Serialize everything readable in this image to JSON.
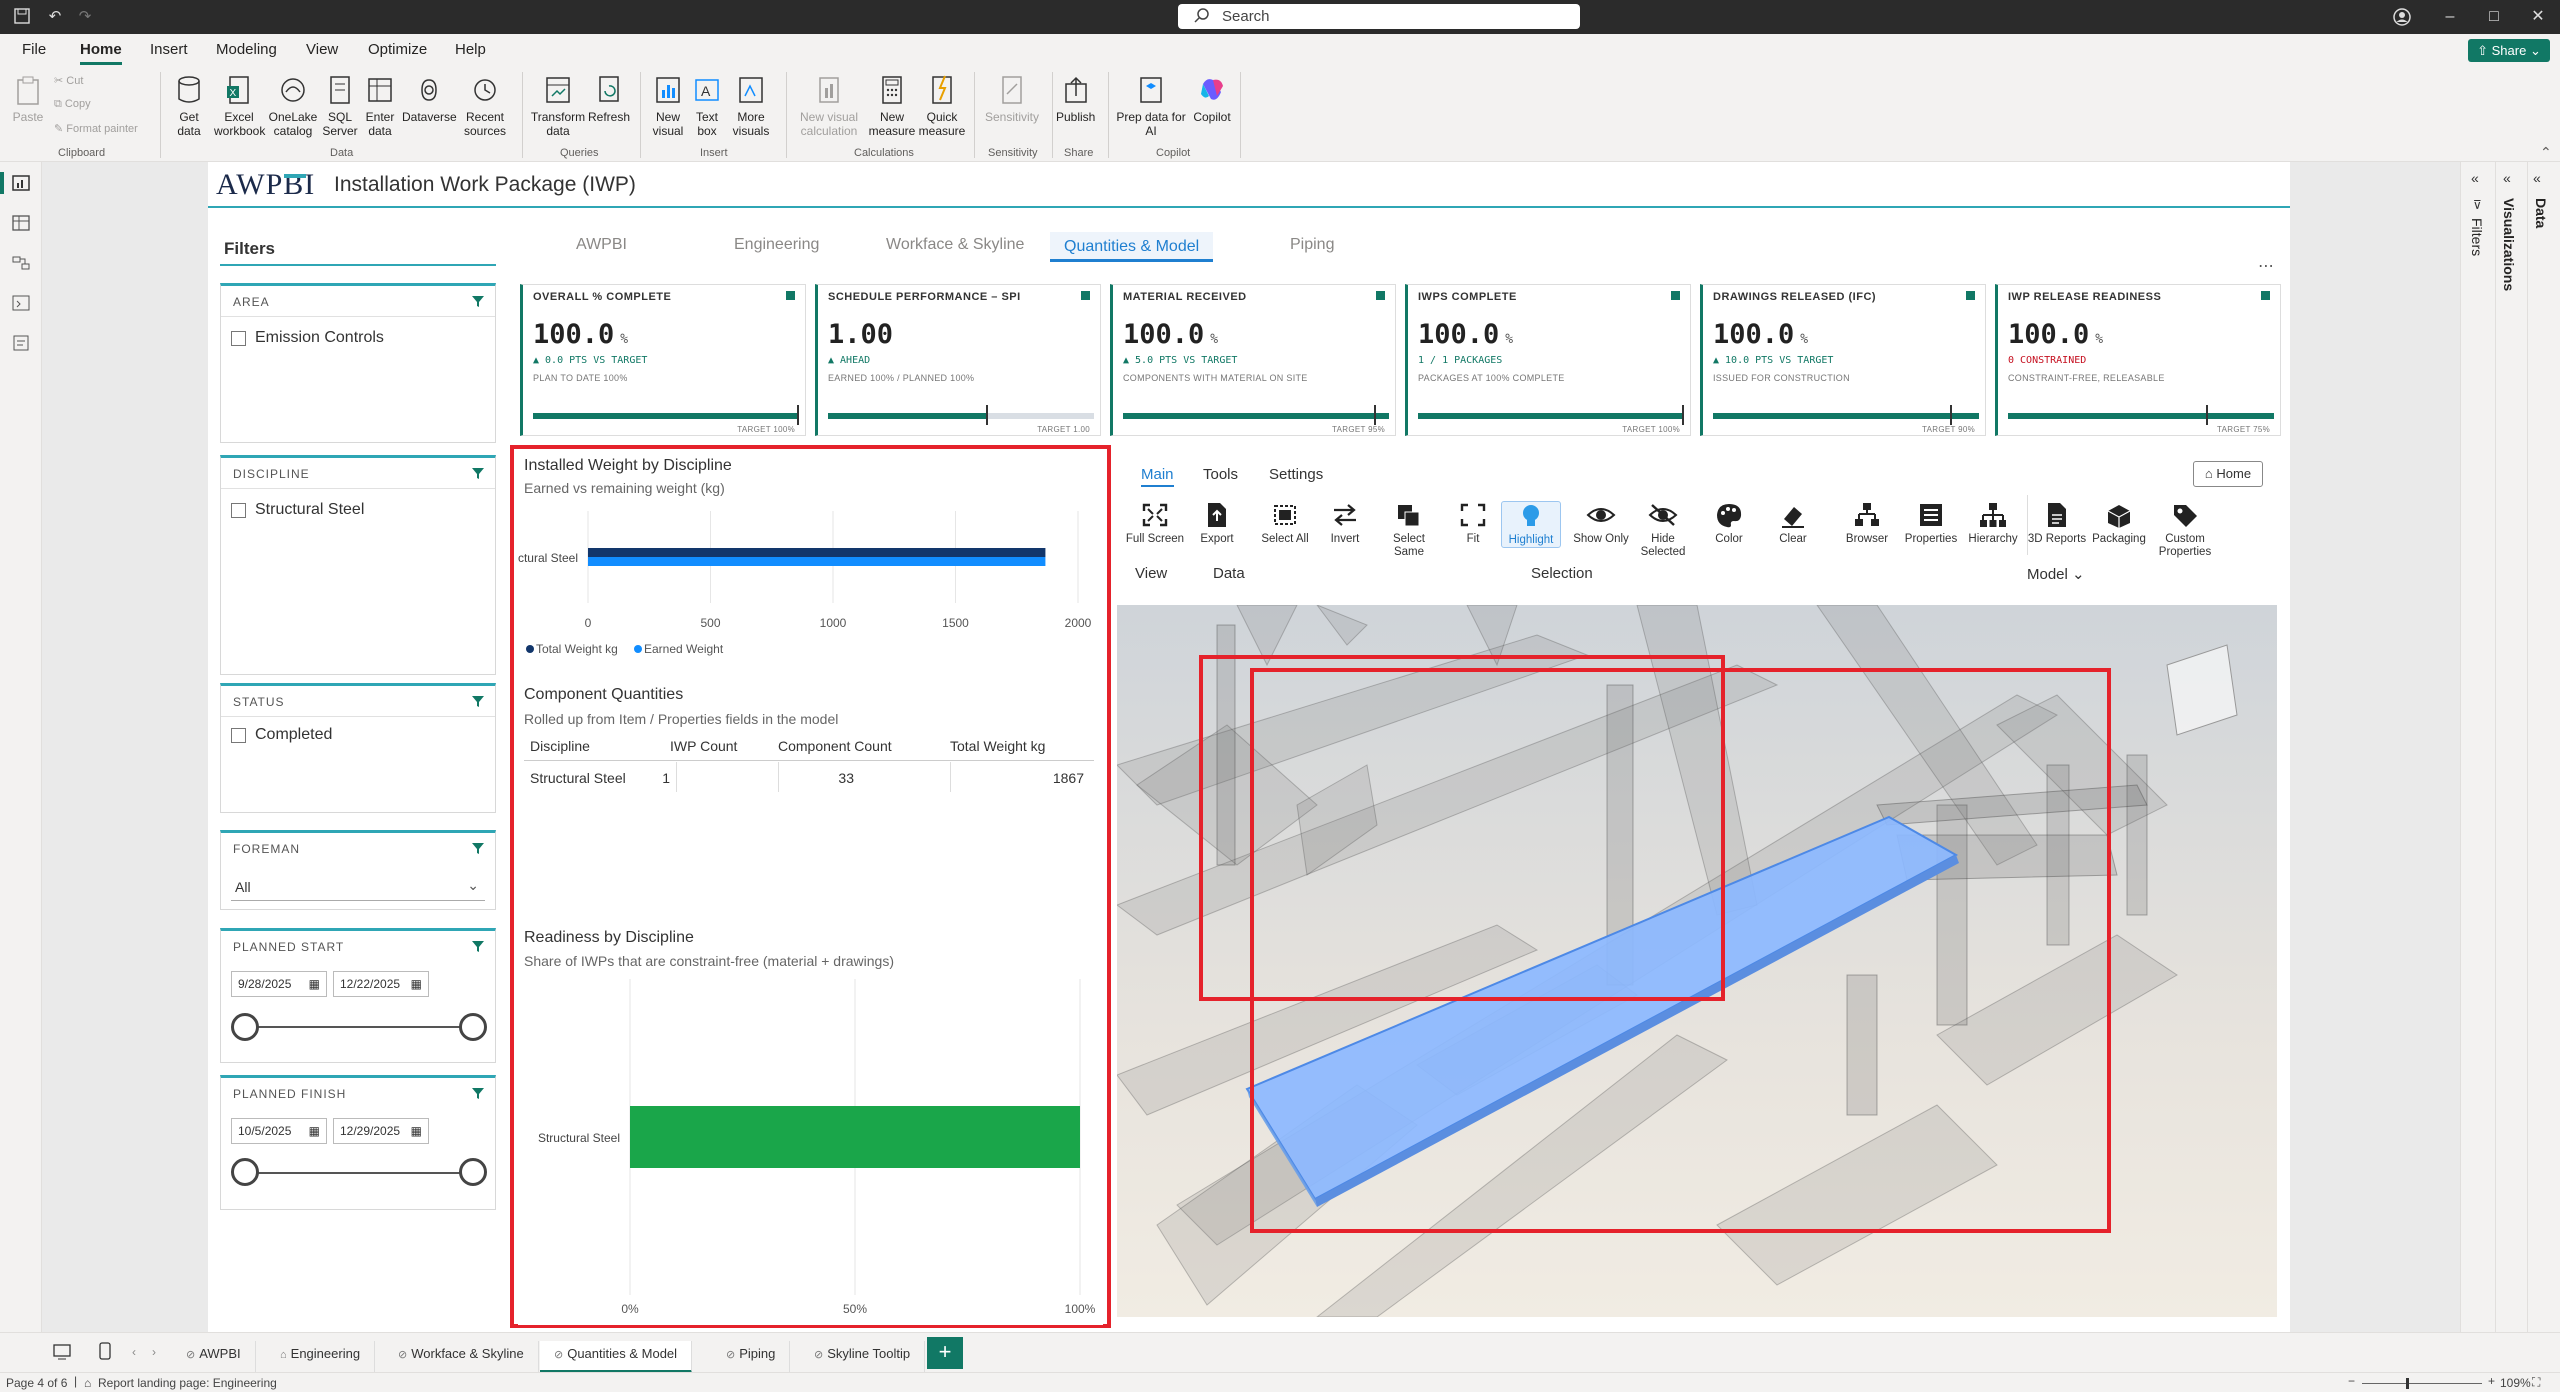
{
  "app": {
    "search_placeholder": "Search",
    "share_label": "Share"
  },
  "menu": [
    "File",
    "Home",
    "Insert",
    "Modeling",
    "View",
    "Optimize",
    "Help"
  ],
  "ribbon": {
    "clipboard": {
      "paste": "Paste",
      "cut": "Cut",
      "copy": "Copy",
      "format_painter": "Format painter",
      "group": "Clipboard"
    },
    "data": {
      "get_data": "Get data",
      "excel": "Excel workbook",
      "onelake": "OneLake catalog",
      "sql": "SQL Server",
      "enter": "Enter data",
      "dataverse": "Dataverse",
      "recent": "Recent sources",
      "group": "Data"
    },
    "queries": {
      "transform": "Transform data",
      "refresh": "Refresh",
      "group": "Queries"
    },
    "insert": {
      "new_visual": "New visual",
      "text_box": "Text box",
      "more_visuals": "More visuals",
      "group": "Insert"
    },
    "calculations": {
      "new_visual_calc": "New visual calculation",
      "new_measure": "New measure",
      "quick_measure": "Quick measure",
      "group": "Calculations"
    },
    "sensitivity": {
      "sensitivity": "Sensitivity",
      "group": "Sensitivity"
    },
    "share": {
      "publish": "Publish",
      "group": "Share"
    },
    "copilot": {
      "prep": "Prep data for AI",
      "copilot": "Copilot",
      "group": "Copilot"
    }
  },
  "panes": {
    "filters": "Filters",
    "visualizations": "Visualizations",
    "data": "Data"
  },
  "report": {
    "logo": "AWPBI",
    "title": "Installation Work Package (IWP)",
    "tabs": [
      "AWPBI",
      "Engineering",
      "Workface & Skyline",
      "Quantities & Model",
      "Piping"
    ],
    "active_tab": "Quantities & Model"
  },
  "filters": {
    "title": "Filters",
    "area": {
      "label": "AREA",
      "option": "Emission Controls"
    },
    "discipline": {
      "label": "DISCIPLINE",
      "option": "Structural Steel"
    },
    "status": {
      "label": "STATUS",
      "option": "Completed"
    },
    "foreman": {
      "label": "FOREMAN",
      "value": "All"
    },
    "planned_start": {
      "label": "PLANNED START",
      "from": "9/28/2025",
      "to": "12/22/2025"
    },
    "planned_finish": {
      "label": "PLANNED FINISH",
      "from": "10/5/2025",
      "to": "12/29/2025"
    }
  },
  "kpis": [
    {
      "title": "OVERALL % COMPLETE",
      "value": "100.0",
      "unit": "%",
      "delta": "▲ 0.0 PTS VS TARGET",
      "sub": "PLAN TO DATE 100%",
      "target": "TARGET 100%",
      "fill": 1.0,
      "tick": 1.0,
      "red": false
    },
    {
      "title": "SCHEDULE PERFORMANCE – SPI",
      "value": "1.00",
      "unit": "",
      "delta": "▲ AHEAD",
      "sub": "EARNED 100% / PLANNED 100%",
      "target": "TARGET 1.00",
      "fill": 0.6,
      "tick": 0.6,
      "red": false
    },
    {
      "title": "MATERIAL RECEIVED",
      "value": "100.0",
      "unit": "%",
      "delta": "▲ 5.0 PTS VS TARGET",
      "sub": "COMPONENTS WITH MATERIAL ON SITE",
      "target": "TARGET 95%",
      "fill": 1.0,
      "tick": 0.95,
      "red": false
    },
    {
      "title": "IWPS COMPLETE",
      "value": "100.0",
      "unit": "%",
      "delta": "1 / 1 PACKAGES",
      "sub": "PACKAGES AT 100% COMPLETE",
      "target": "TARGET 100%",
      "fill": 1.0,
      "tick": 1.0,
      "red": false
    },
    {
      "title": "DRAWINGS RELEASED (IFC)",
      "value": "100.0",
      "unit": "%",
      "delta": "▲ 10.0 PTS VS TARGET",
      "sub": "ISSUED FOR CONSTRUCTION",
      "target": "TARGET 90%",
      "fill": 1.0,
      "tick": 0.9,
      "red": false
    },
    {
      "title": "IWP RELEASE READINESS",
      "value": "100.0",
      "unit": "%",
      "delta": "0 CONSTRAINED",
      "sub": "CONSTRAINT-FREE, RELEASABLE",
      "target": "TARGET 75%",
      "fill": 1.0,
      "tick": 0.75,
      "red": true
    }
  ],
  "chart_data": [
    {
      "type": "bar",
      "title": "Installed Weight by Discipline",
      "subtitle": "Earned vs remaining weight (kg)",
      "categories": [
        "Structural Steel"
      ],
      "series": [
        {
          "name": "Total Weight kg",
          "values": [
            1867
          ],
          "color": "#12366b"
        },
        {
          "name": "Earned Weight",
          "values": [
            1867
          ],
          "color": "#118dff"
        }
      ],
      "xlim": [
        0,
        2000
      ],
      "ticks": [
        "0",
        "500",
        "1000",
        "1500",
        "2000"
      ],
      "legend": "bottom-left"
    },
    {
      "type": "table",
      "title": "Component Quantities",
      "subtitle": "Rolled up from Item / Properties fields in the model",
      "columns": [
        "Discipline",
        "IWP Count",
        "Component Count",
        "Total Weight kg"
      ],
      "rows": [
        [
          "Structural Steel",
          "1",
          "33",
          "1867"
        ]
      ]
    },
    {
      "type": "bar",
      "title": "Readiness by Discipline",
      "subtitle": "Share of IWPs that are constraint-free (material + drawings)",
      "categories": [
        "Structural Steel"
      ],
      "series": [
        {
          "values": [
            1.0
          ],
          "color": "#1aa64a"
        }
      ],
      "xlim": [
        0,
        1
      ],
      "ticks": [
        "0%",
        "50%",
        "100%"
      ]
    }
  ],
  "viewer": {
    "tabs": [
      "Main",
      "Tools",
      "Settings"
    ],
    "home": "Home",
    "tools": [
      {
        "label": "Full Screen",
        "icon": "fullscreen-icon"
      },
      {
        "label": "Export",
        "icon": "export-icon"
      },
      {
        "label": "Select All",
        "icon": "select-all-icon"
      },
      {
        "label": "Invert",
        "icon": "invert-icon"
      },
      {
        "label": "Select Same",
        "icon": "select-same-icon"
      },
      {
        "label": "Fit",
        "icon": "fit-icon"
      },
      {
        "label": "Highlight",
        "icon": "highlight-icon"
      },
      {
        "label": "Show Only",
        "icon": "show-only-icon"
      },
      {
        "label": "Hide Selected",
        "icon": "hide-selected-icon"
      },
      {
        "label": "Color",
        "icon": "color-icon"
      },
      {
        "label": "Clear",
        "icon": "clear-icon"
      },
      {
        "label": "Browser",
        "icon": "browser-icon"
      },
      {
        "label": "Properties",
        "icon": "properties-icon"
      },
      {
        "label": "Hierarchy",
        "icon": "hierarchy-icon"
      },
      {
        "label": "3D Reports",
        "icon": "reports-icon"
      },
      {
        "label": "Packaging",
        "icon": "packaging-icon"
      },
      {
        "label": "Custom Properties",
        "icon": "custom-properties-icon"
      }
    ],
    "groups": {
      "view": "View",
      "data": "Data",
      "selection": "Selection",
      "model": "Model"
    }
  },
  "page_tabs": [
    "AWPBI",
    "Engineering",
    "Workface & Skyline",
    "Quantities & Model",
    "Piping",
    "Skyline Tooltip"
  ],
  "status": {
    "page": "Page 4 of 6",
    "landing": "Report landing page: Engineering",
    "zoom": "109%"
  },
  "colors": {
    "accent": "#117865",
    "teal": "#2fa6b5",
    "highlight_box": "#e5222b"
  }
}
